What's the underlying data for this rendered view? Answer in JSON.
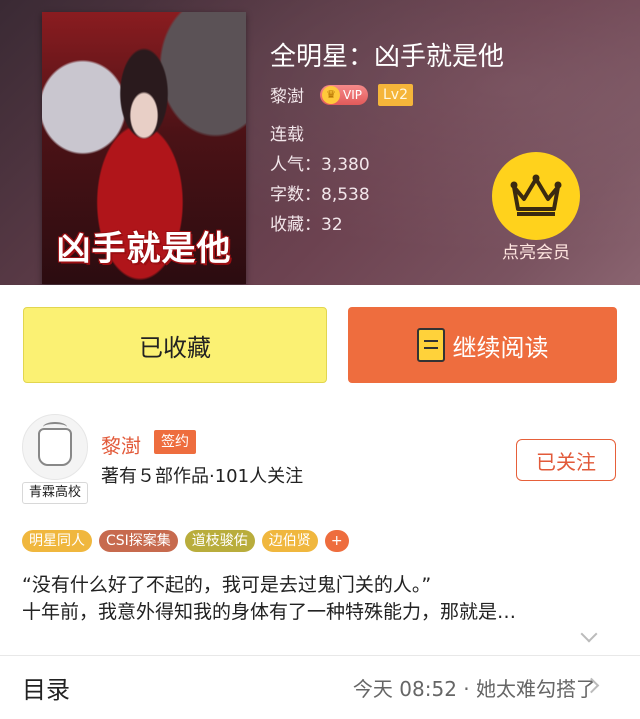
{
  "book": {
    "title": "全明星：凶手就是他",
    "cover_title": "凶手就是他",
    "author": "黎澍",
    "vip_label": "VIP",
    "level": "Lv2",
    "status": "连载",
    "popularity": "人气：3,380",
    "word_count": "字数：8,538",
    "favorites": "收藏：32"
  },
  "membership": {
    "label": "点亮会员",
    "icon": "crown-icon",
    "color": "#ffd21c"
  },
  "actions": {
    "collected_label": "已收藏",
    "read_label": "继续阅读",
    "read_icon": "book-icon"
  },
  "author_block": {
    "name": "黎澍",
    "sign_badge": "签约",
    "stats": "著有５部作品·101人关注",
    "school_tag": "青霖高校",
    "follow_label": "已关注"
  },
  "tags": [
    {
      "label": "明星同人",
      "color": "#f0b73e"
    },
    {
      "label": "CSI探案集",
      "color": "#c76a4e"
    },
    {
      "label": "道枝骏佑",
      "color": "#b9ad3c"
    },
    {
      "label": "边伯贤",
      "color": "#f0b73e"
    }
  ],
  "tags_more": "+",
  "synopsis": {
    "line1": "“没有什么好了不起的，我可是去过鬼门关的人。”",
    "line2": "十年前，我意外得知我的身体有了一种特殊能力，那就是…"
  },
  "catalog": {
    "title": "目录",
    "latest": "今天 08:52 · 她太难勾搭了"
  },
  "colors": {
    "accent": "#ee6d3e",
    "collected_bg": "#fbf173"
  }
}
